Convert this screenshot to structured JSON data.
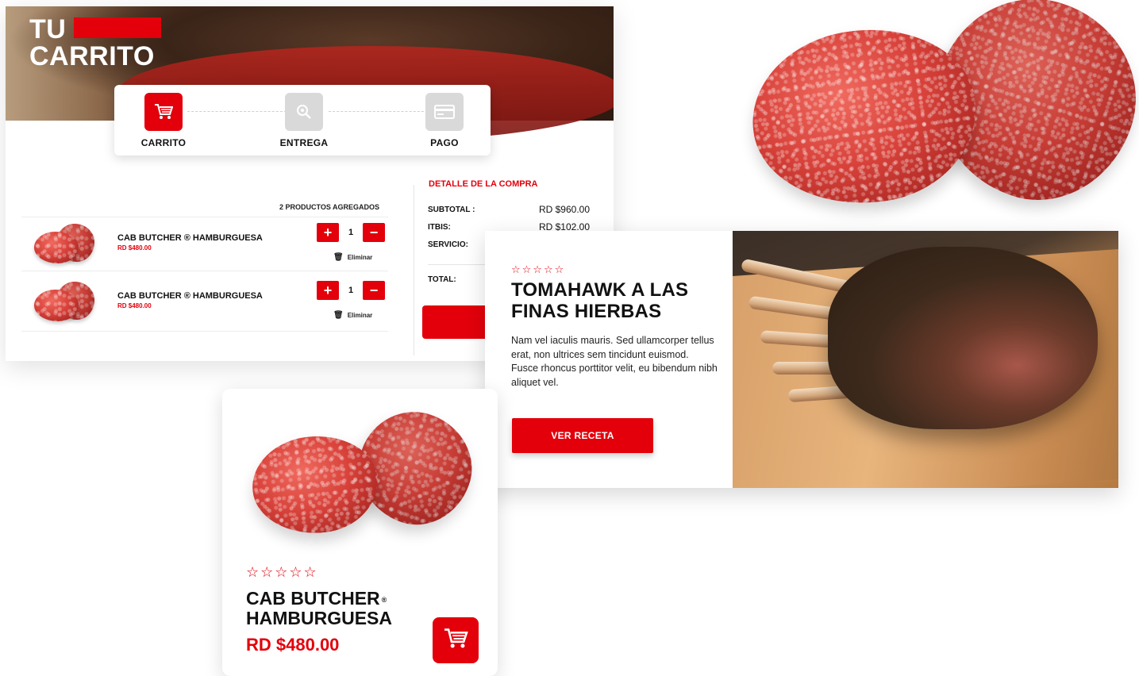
{
  "cart": {
    "title_line1": "TU",
    "title_line2": "CARRITO",
    "steps": [
      {
        "label": "CARRITO",
        "icon": "shopping-cart-icon",
        "active": true
      },
      {
        "label": "ENTREGA",
        "icon": "location-pin-icon",
        "active": false
      },
      {
        "label": "PAGO",
        "icon": "credit-card-icon",
        "active": false
      }
    ],
    "products_count_label": "2 PRODUCTOS AGREGADOS",
    "items": [
      {
        "name": "CAB BUTCHER ® HAMBURGUESA",
        "price": "RD $480.00",
        "quantity": "1",
        "remove_label": "Eliminar"
      },
      {
        "name": "CAB BUTCHER ® HAMBURGUESA",
        "price": "RD $480.00",
        "quantity": "1",
        "remove_label": "Eliminar"
      }
    ],
    "plus_symbol": "+",
    "minus_symbol": "−",
    "detail": {
      "title": "DETALLE DE LA COMPRA",
      "subtotal_label": "SUBTOTAL :",
      "subtotal_value": "RD $960.00",
      "itbis_label": "ITBIS:",
      "itbis_value": "RD $102.00",
      "service_label": "SERVICIO:",
      "total_label": "TOTAL:"
    }
  },
  "recipe": {
    "rating_stars": "☆☆☆☆☆",
    "title_line1": "TOMAHAWK A LAS",
    "title_line2": "FINAS HIERBAS",
    "body": "Nam vel iaculis mauris. Sed ullamcorper tellus erat, non ultrices sem tincidunt euismod. Fusce rhoncus porttitor velit, eu bibendum nibh aliquet vel.",
    "button_label": "VER RECETA"
  },
  "product_card": {
    "rating_stars": "☆☆☆☆☆",
    "title_line1": "CAB BUTCHER",
    "registered_mark": "®",
    "title_line2": "HAMBURGUESA",
    "price": "RD $480.00"
  },
  "colors": {
    "accent": "#e3000b",
    "inactive_step": "#d9d9d9",
    "text": "#111111"
  }
}
